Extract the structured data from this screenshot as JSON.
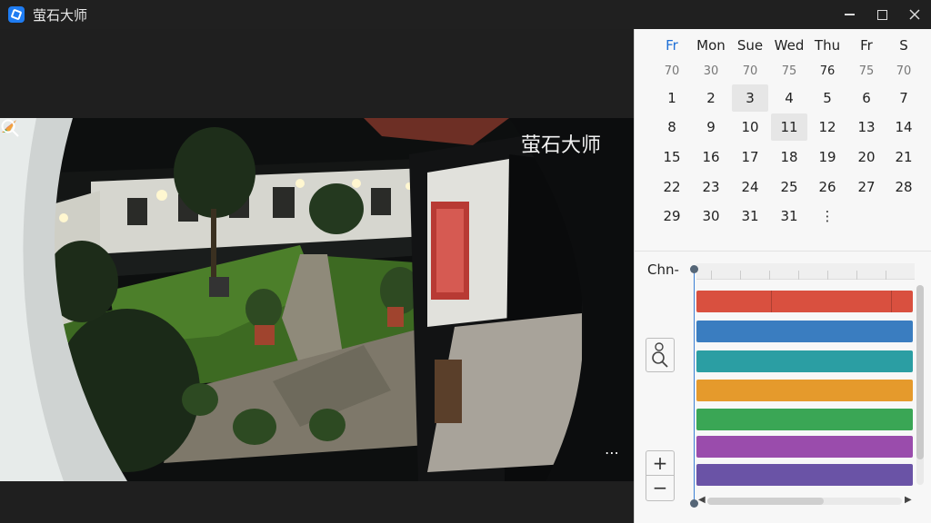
{
  "app": {
    "title": "萤石大师",
    "icon": "app-logo-icon"
  },
  "window_controls": [
    "minimize-icon",
    "maximize-icon",
    "close-icon"
  ],
  "video": {
    "watermark": "萤石大师",
    "controls": [
      "zoom-icon",
      "more-icon"
    ],
    "more_label": "⋯"
  },
  "calendar": {
    "weekdays": [
      "Fr",
      "Mon",
      "Sue",
      "Wed",
      "Thu",
      "Fr",
      "S"
    ],
    "today_weekday_index": 0,
    "faded_row": [
      "70",
      "30",
      "70",
      "75",
      "76",
      "75",
      "70"
    ],
    "rows": [
      [
        "1",
        "2",
        "3",
        "4",
        "5",
        "6",
        "7"
      ],
      [
        "8",
        "9",
        "10",
        "11",
        "12",
        "13",
        "14"
      ],
      [
        "15",
        "16",
        "17",
        "18",
        "19",
        "20",
        "21"
      ],
      [
        "22",
        "23",
        "24",
        "25",
        "26",
        "27",
        "28"
      ],
      [
        "29",
        "30",
        "31",
        "31",
        "⋮",
        "",
        ""
      ]
    ],
    "highlighted": [
      "3",
      "11"
    ]
  },
  "timeline": {
    "channel_label": "Chn-",
    "tracks": [
      {
        "color": "#d9503f"
      },
      {
        "color": "#3a7dc0"
      },
      {
        "color": "#2b9ea3"
      },
      {
        "color": "#e59a2c"
      },
      {
        "color": "#3aa655"
      },
      {
        "color": "#9a4cac"
      },
      {
        "color": "#6a53a6"
      }
    ],
    "zoom_in_label": "+",
    "zoom_out_label": "−",
    "search_icon": "search-person-icon"
  }
}
